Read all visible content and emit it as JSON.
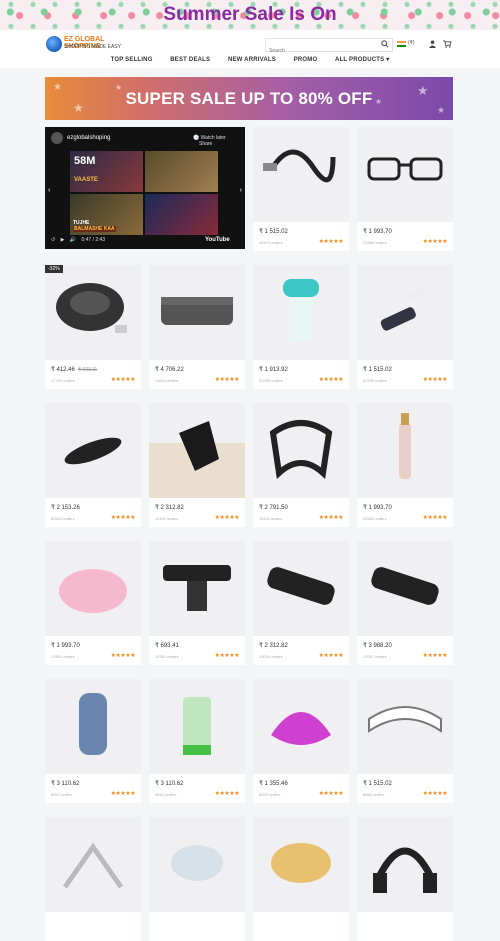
{
  "top_banner": {
    "text": "Summer Sale Is On"
  },
  "header": {
    "logo_line1": "EZ GLOBAL SHOPPING",
    "logo_line2": "SHOPPING MADE EASY",
    "search_placeholder": "Search",
    "currency": "(₹)"
  },
  "nav": [
    "TOP SELLING",
    "BEST DEALS",
    "NEW ARRIVALS",
    "PROMO",
    "ALL PRODUCTS ▾"
  ],
  "promo_banner": {
    "text": "SUPER SALE UP TO 80% OFF"
  },
  "video": {
    "channel": "ezglobalshoping",
    "watch_later": "Watch later",
    "share": "Share",
    "time": "0:47 / 2:43",
    "brand": "YouTube",
    "thumb_text": [
      "58M",
      "VAASTE",
      "TUJHE",
      "BALMASHE KAA"
    ]
  },
  "products": [
    {
      "price": "₹ 1 515.02",
      "old": "",
      "orders": "42673 orders",
      "stars": "★★★★★"
    },
    {
      "price": "₹ 1 993.70",
      "old": "",
      "orders": "22666 orders",
      "stars": "★★★★★"
    },
    {
      "price": "₹ 412.46",
      "old": "₹ 603.11",
      "orders": "17700 orders",
      "stars": "★★★★★",
      "badge": "-32%"
    },
    {
      "price": "₹ 4 706.22",
      "old": "",
      "orders": "11664 orders",
      "stars": "★★★★★"
    },
    {
      "price": "₹ 1 913.92",
      "old": "",
      "orders": "32039 orders",
      "stars": "★★★★★"
    },
    {
      "price": "₹ 1 515.02",
      "old": "",
      "orders": "52230 orders",
      "stars": "★★★★★"
    },
    {
      "price": "₹ 2 153.26",
      "old": "",
      "orders": "52524 orders",
      "stars": "★★★★★"
    },
    {
      "price": "₹ 2 312.82",
      "old": "",
      "orders": "11392 orders",
      "stars": "★★★★★"
    },
    {
      "price": "₹ 2 791.50",
      "old": "",
      "orders": "11526 orders",
      "stars": "★★★★★"
    },
    {
      "price": "₹ 1 993.70",
      "old": "",
      "orders": "20350 orders",
      "stars": "★★★★★"
    },
    {
      "price": "₹ 1 993.70",
      "old": "",
      "orders": "12691 orders",
      "stars": "★★★★★"
    },
    {
      "price": "₹ 693.41",
      "old": "",
      "orders": "10361 orders",
      "stars": "★★★★★"
    },
    {
      "price": "₹ 2 312.82",
      "old": "",
      "orders": "10049 orders",
      "stars": "★★★★★"
    },
    {
      "price": "₹ 3 988.20",
      "old": "",
      "orders": "12067 orders",
      "stars": "★★★★★"
    },
    {
      "price": "₹ 3 110.62",
      "old": "",
      "orders": "5920 orders",
      "stars": "★★★★★"
    },
    {
      "price": "₹ 3 110.62",
      "old": "",
      "orders": "9634 orders",
      "stars": "★★★★★"
    },
    {
      "price": "₹ 1 355.46",
      "old": "",
      "orders": "6529 orders",
      "stars": "★★★★★"
    },
    {
      "price": "₹ 1 515.02",
      "old": "",
      "orders": "8565 orders",
      "stars": "★★★★★"
    },
    {
      "price": "",
      "old": "",
      "orders": "",
      "stars": ""
    },
    {
      "price": "",
      "old": "",
      "orders": "",
      "stars": ""
    },
    {
      "price": "",
      "old": "",
      "orders": "",
      "stars": ""
    },
    {
      "price": "",
      "old": "",
      "orders": "",
      "stars": ""
    }
  ],
  "product_icons": [
    "usb-cable-icon",
    "glasses-icon",
    "mouse-icon",
    "bag-icon",
    "water-bottle-icon",
    "hair-brush-icon",
    "bike-light-icon",
    "glove-icon",
    "posture-corrector-icon",
    "trimmer-icon",
    "soap-box-icon",
    "phone-holder-icon",
    "seat-gap-organizer-icon",
    "seat-gap-organizer-icon",
    "speaker-icon",
    "blender-icon",
    "hair-claw-icon",
    "headband-icon",
    "stand-icon",
    "lamp-icon",
    "sponge-icon",
    "headphones-icon"
  ]
}
